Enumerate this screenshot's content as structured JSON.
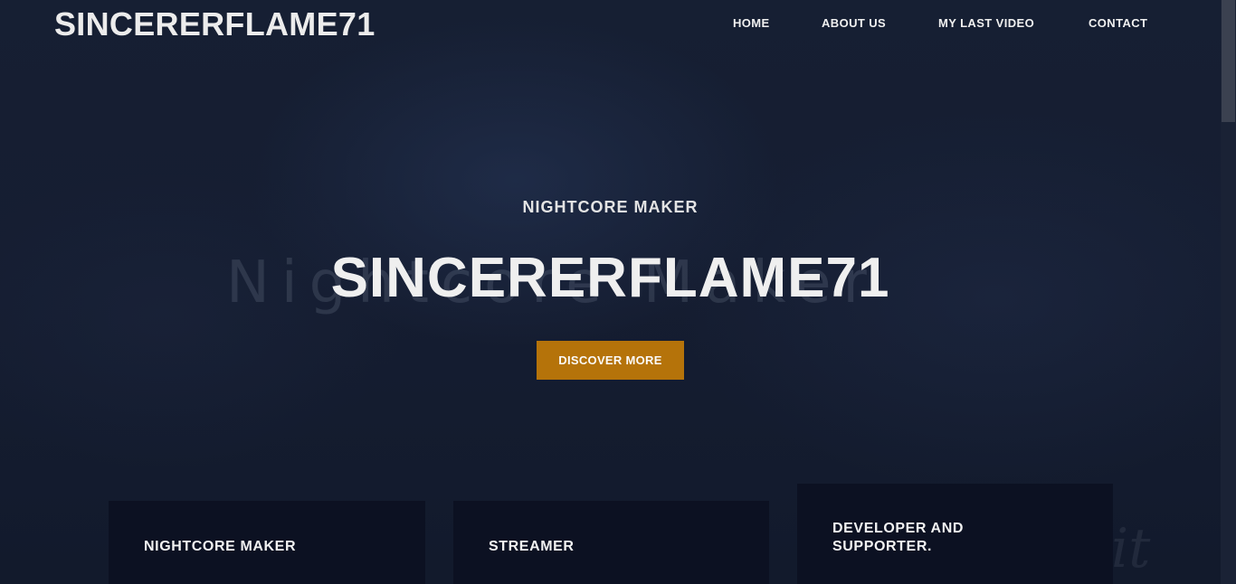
{
  "header": {
    "brand": "SINCERERFLAME71",
    "nav": [
      {
        "label": "HOME"
      },
      {
        "label": "ABOUT US"
      },
      {
        "label": "MY LAST VIDEO"
      },
      {
        "label": "CONTACT"
      }
    ]
  },
  "hero": {
    "background_text": "Nightcore Maker",
    "subtitle": "NIGHTCORE MAKER",
    "title": "SINCERERFLAME71",
    "cta_label": "DISCOVER MORE"
  },
  "cards": [
    {
      "title": "NIGHTCORE MAKER"
    },
    {
      "title": "STREAMER"
    },
    {
      "title": "DEVELOPER AND SUPPORTER."
    }
  ],
  "colors": {
    "background": "#131b2e",
    "card": "#0c1122",
    "accent": "#b5730a",
    "text": "#efefef"
  }
}
